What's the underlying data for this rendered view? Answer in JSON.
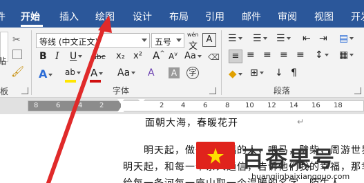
{
  "tabs": [
    {
      "label": "开始",
      "active": true
    },
    {
      "label": "插入"
    },
    {
      "label": "绘图"
    },
    {
      "label": "设计"
    },
    {
      "label": "布局"
    },
    {
      "label": "引用"
    },
    {
      "label": "邮件"
    },
    {
      "label": "审阅"
    },
    {
      "label": "视图"
    },
    {
      "label": "开发"
    }
  ],
  "clipboard": {
    "label": "剪贴板",
    "label_visible": "板",
    "paste_label": "贴"
  },
  "font": {
    "group_label": "字体",
    "family": "等线 (中文正文)",
    "size": "五号",
    "wen_icon_text": "wén",
    "wen_char": "文",
    "grow": "A",
    "shrink": "A",
    "case": "Aa",
    "char_border": "A",
    "bold": "B",
    "italic": "I",
    "underline": "U",
    "strike": "abc",
    "subscript": "x₂",
    "superscript": "x²",
    "effects": "A",
    "highlight": "ab",
    "font_color": "A",
    "shading": "A",
    "enclose": "字"
  },
  "paragraph": {
    "group_label": "段落"
  },
  "ruler": {
    "numbers": [
      "8",
      "6",
      "4",
      "2",
      "2",
      "4",
      "6",
      "8",
      "10",
      "12",
      "14",
      "16",
      "18"
    ]
  },
  "document": {
    "lines": [
      "面朝大海，春暖花开",
      "明天起，做一个幸福的人，喂马，劈柴，周游世界",
      "明天起，和每一个亲人通信，告诉他们我的幸福，那幸",
      "给每一条河每一座山取一个温暖的名字，陌生人"
    ]
  },
  "watermark": {
    "brand": "百香果号",
    "url": "huangjinbaixiangguo.com"
  },
  "colors": {
    "ribbon_blue": "#2b579a",
    "arrow_red": "#e02a2a",
    "highlight_yellow": "#ffe600",
    "font_red": "#d01010",
    "accent_blue": "#2b6cd6"
  }
}
